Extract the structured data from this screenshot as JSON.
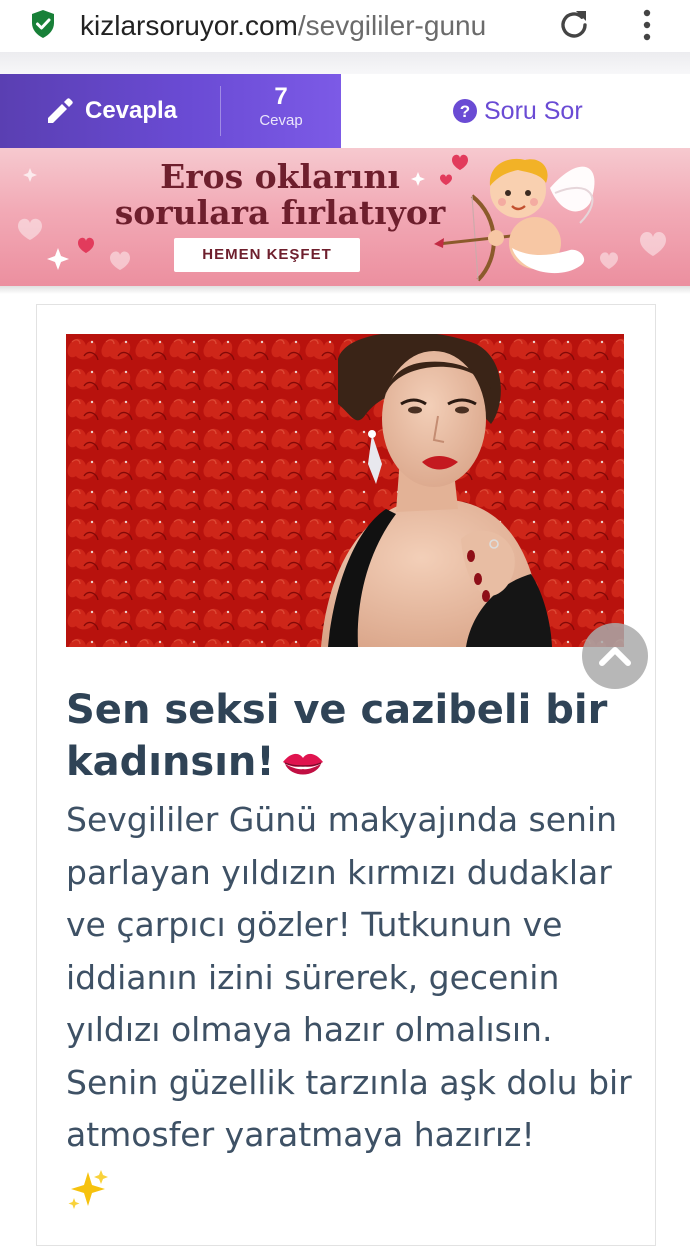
{
  "browser": {
    "url_host": "kizlarsoruyor.com",
    "url_path": "/sevgililer-gunu",
    "security_icon": "shield-check-icon",
    "reload_icon": "reload-icon",
    "menu_icon": "kebab-menu-icon"
  },
  "action_bar": {
    "answer_label": "Cevapla",
    "answer_count": "7",
    "answer_count_label": "Cevap",
    "ask_label": "Soru Sor"
  },
  "banner": {
    "line1": "Eros oklarını",
    "line2": "sorulara fırlatıyor",
    "cta": "HEMEN KEŞFET"
  },
  "card": {
    "headline": "Sen seksi ve cazibeli bir kadınsın!",
    "headline_emoji": "kiss-lips-icon",
    "body": "Sevgililer Günü makyajında senin parlayan yıldızın kırmızı dudaklar ve çarpıcı gözler! Tutkunun ve iddianın izini sürerek, gecenin yıldızı olmaya hazır olmalısın. Senin güzellik tarzınla aşk dolu bir atmosfer yaratmaya hazırız!",
    "body_emoji": "sparkles-icon"
  },
  "colors": {
    "accent": "#6a4bd4",
    "headline": "#2f4356",
    "body": "#3e5165",
    "banner_text": "#6e1f2d"
  }
}
